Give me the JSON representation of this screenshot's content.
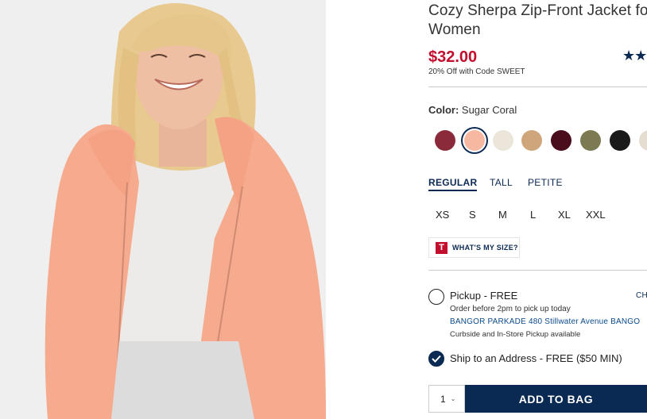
{
  "product": {
    "title": "Cozy Sherpa Zip-Front Jacket for Women",
    "price": "$32.00",
    "promo": "20% Off with Code SWEET",
    "stars": "★★"
  },
  "color": {
    "label": "Color:",
    "selected": "Sugar Coral",
    "swatches": [
      {
        "name": "maroon-floral",
        "color": "#8a2a3a"
      },
      {
        "name": "sugar-coral",
        "color": "#f7b8a2"
      },
      {
        "name": "cream",
        "color": "#ece6da"
      },
      {
        "name": "camel",
        "color": "#cfa67c"
      },
      {
        "name": "dark-wine",
        "color": "#4a0d1c"
      },
      {
        "name": "olive-camo",
        "color": "#7c7a52"
      },
      {
        "name": "black",
        "color": "#1a1a1a"
      },
      {
        "name": "oatmeal",
        "color": "#e4ddd0"
      }
    ]
  },
  "fits": [
    "REGULAR",
    "TALL",
    "PETITE"
  ],
  "sizes": [
    "XS",
    "S",
    "M",
    "L",
    "XL",
    "XXL"
  ],
  "size_help": {
    "badge": "T",
    "label": "WHAT'S MY SIZE?"
  },
  "pickup": {
    "title": "Pickup - FREE",
    "change": "CHA",
    "note": "Order before 2pm to pick up today",
    "store": "BANGOR PARKADE 480 Stillwater Avenue  BANGO",
    "curbside": "Curbside and In-Store Pickup available"
  },
  "ship": {
    "title": "Ship to an Address - FREE ($50 MIN)"
  },
  "quantity": {
    "value": "1"
  },
  "add_to_bag": "ADD TO BAG",
  "colors": {
    "accent": "#0b2a53",
    "price": "#c40e2d",
    "jacket": "#f7ab8e"
  }
}
